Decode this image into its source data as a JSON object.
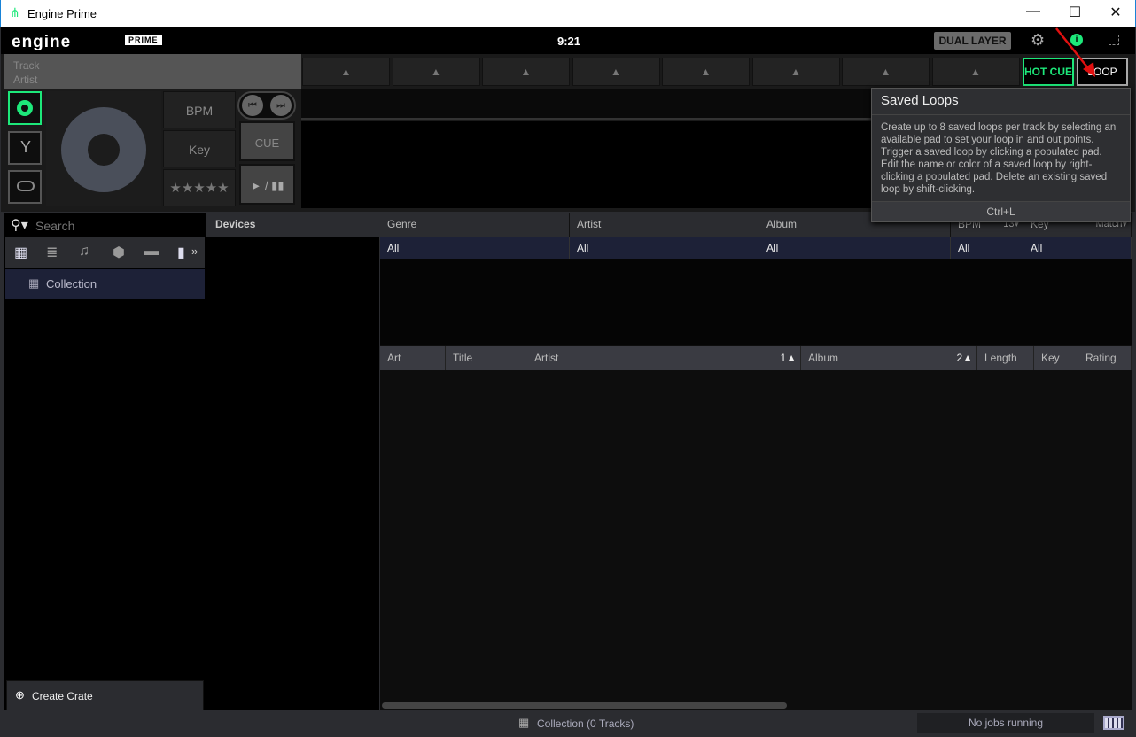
{
  "window": {
    "title": "Engine Prime",
    "min": "—",
    "max": "☐",
    "close": "✕"
  },
  "app": {
    "logo": "engine",
    "logo_sub": "PRIME",
    "clock": "9:21",
    "dual_layer": "DUAL LAYER"
  },
  "deck": {
    "track": "Track",
    "artist": "Artist",
    "bpm": "BPM",
    "key": "Key",
    "rating": "★★★★★",
    "cue": "CUE",
    "play_pause": "► / ▮▮",
    "prev": "⏮",
    "next": "⏭",
    "pad_icon": "▲",
    "hot_cue": "HOT CUE",
    "loop": "LOOP",
    "accent": "#1de87a"
  },
  "tooltip": {
    "title": "Saved Loops",
    "body": "Create up to 8 saved loops per track by selecting an available pad to set your loop in and out points. Trigger a saved loop by clicking a populated pad. Edit the name or color of a saved loop by right-clicking a populated pad. Delete an existing saved loop by shift-clicking.",
    "shortcut": "Ctrl+L"
  },
  "sidebar": {
    "search_placeholder": "Search",
    "more": "»",
    "collection": "Collection",
    "create_crate": "Create Crate"
  },
  "devices": {
    "title": "Devices"
  },
  "filters": {
    "columns": [
      "Genre",
      "Artist",
      "Album",
      "BPM",
      "Key"
    ],
    "bpm_extra": "13▾",
    "key_extra": "Match▾",
    "values": [
      "All",
      "All",
      "All",
      "All",
      "All"
    ]
  },
  "tracks": {
    "columns": [
      "Art",
      "Title",
      "Artist",
      "Album",
      "Length",
      "Key",
      "Rating"
    ],
    "artist_sort": "1▲",
    "album_sort": "2▲"
  },
  "status": {
    "collection": "Collection (0 Tracks)",
    "jobs": "No jobs running"
  }
}
